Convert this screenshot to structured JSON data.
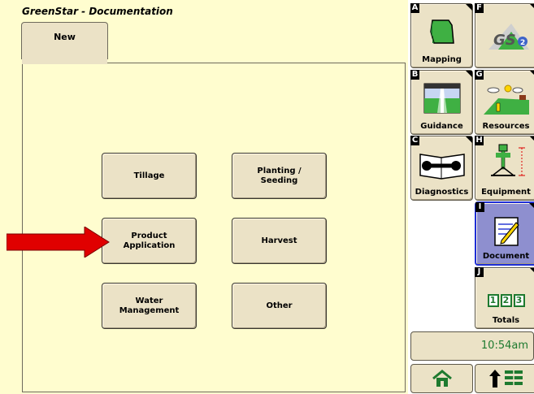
{
  "app_title": "GreenStar - Documentation",
  "tabs": [
    {
      "label": "New"
    }
  ],
  "categories": [
    {
      "label": "Tillage"
    },
    {
      "label": "Planting /\nSeeding"
    },
    {
      "label": "Product\nApplication"
    },
    {
      "label": "Harvest"
    },
    {
      "label": "Water\nManagement"
    },
    {
      "label": "Other"
    }
  ],
  "softkeys": {
    "A": {
      "key": "A",
      "label": "Mapping",
      "icon": "field-map-icon"
    },
    "F": {
      "key": "F",
      "label": "",
      "icon": "gs2-logo-icon"
    },
    "B": {
      "key": "B",
      "label": "Guidance",
      "icon": "guidance-icon"
    },
    "G": {
      "key": "G",
      "label": "Resources",
      "icon": "resources-icon"
    },
    "C": {
      "key": "C",
      "label": "Diagnostics",
      "icon": "wrench-manual-icon"
    },
    "H": {
      "key": "H",
      "label": "Equipment",
      "icon": "tractor-equipment-icon"
    },
    "I": {
      "key": "I",
      "label": "Document",
      "icon": "document-icon"
    },
    "J": {
      "key": "J",
      "label": "Totals",
      "icon": "totals-icon",
      "digits": [
        "1",
        "2",
        "3"
      ]
    }
  },
  "clock": "10:54am",
  "bottom_buttons": [
    {
      "icon": "home-icon"
    },
    {
      "icon": "up-arrow-menu-icon"
    }
  ],
  "colors": {
    "background": "#fffdcf",
    "button": "#ebe2c6",
    "active_button": "#8e8fcf",
    "accent_green": "#1e7a2f",
    "arrow": "#e00000"
  }
}
